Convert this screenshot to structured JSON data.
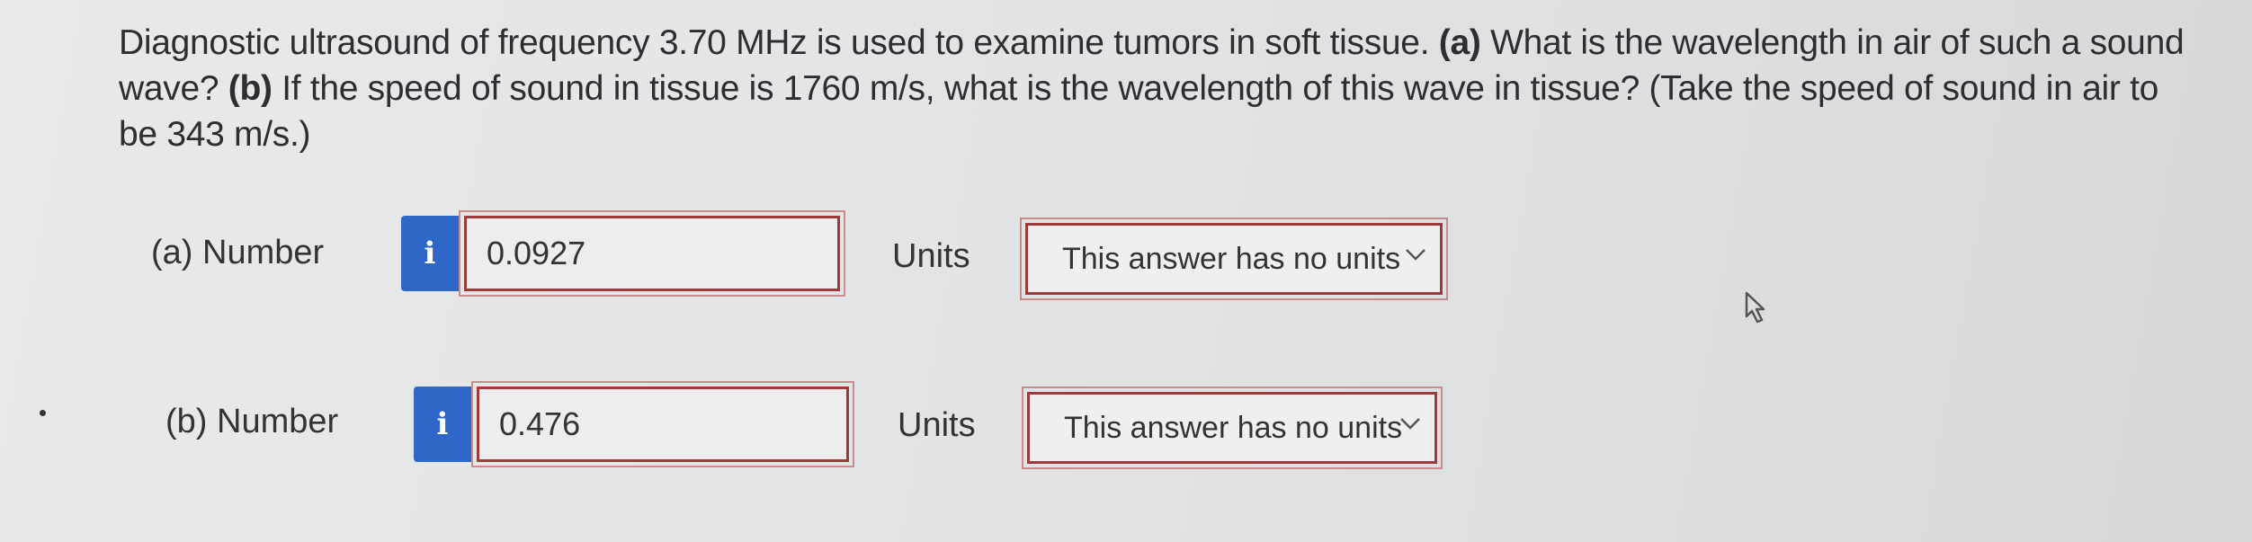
{
  "question": {
    "intro": "Diagnostic ultrasound of frequency 3.70 MHz is used to examine tumors in soft tissue. ",
    "part_a_tag": "(a)",
    "part_a_text": " What is the wavelength in air of such a sound wave? ",
    "part_b_tag": "(b)",
    "part_b_text": " If the speed of sound in tissue is 1760 m/s, what is the wavelength of this wave in tissue? (Take the speed of sound in air to be 343 m/s.)"
  },
  "parts": [
    {
      "label": "(a)  Number",
      "info": "i",
      "value": "0.0927",
      "units_label": "Units",
      "units_value": "This answer has no units"
    },
    {
      "label": "(b)  Number",
      "info": "i",
      "value": "0.476",
      "units_label": "Units",
      "units_value": "This answer has no units"
    }
  ],
  "colors": {
    "info_button": "#2f67c8",
    "input_border": "#a03a3a"
  }
}
